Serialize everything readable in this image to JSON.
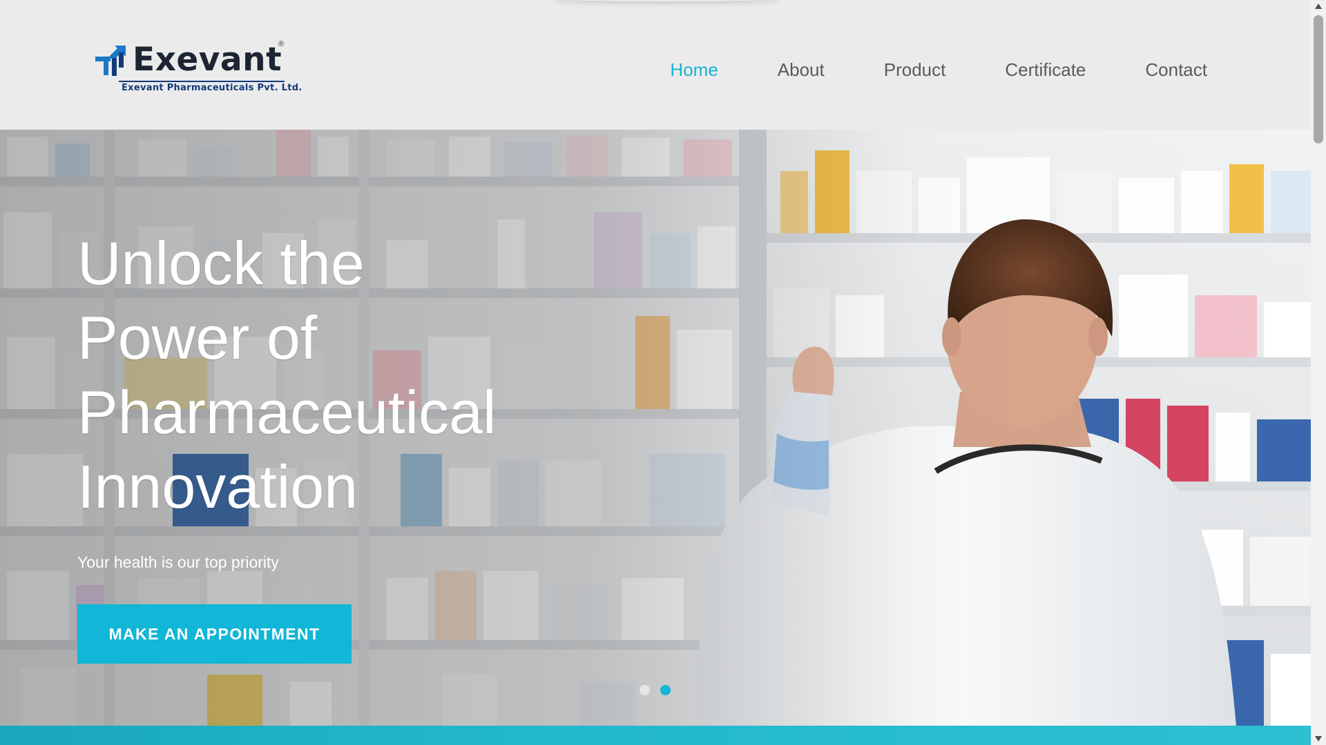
{
  "header": {
    "logo": {
      "name": "Exevant",
      "registered": "®",
      "tagline": "Exevant Pharmaceuticals Pvt. Ltd."
    },
    "nav": [
      {
        "label": "Home",
        "active": true
      },
      {
        "label": "About",
        "active": false
      },
      {
        "label": "Product",
        "active": false
      },
      {
        "label": "Certificate",
        "active": false
      },
      {
        "label": "Contact",
        "active": false
      }
    ]
  },
  "hero": {
    "title_lines": [
      "Unlock the",
      "Power of",
      "Pharmaceutical",
      "Innovation"
    ],
    "subtitle": "Your health is our top priority",
    "cta_label": "MAKE AN APPOINTMENT",
    "carousel": {
      "total_slides": 2,
      "active_slide": 2
    },
    "background_image": "pharmacist-at-pharmacy-shelves"
  },
  "colors": {
    "accent": "#12b6d6",
    "nav_text": "#5a5a5a",
    "brand_dark": "#1d2433",
    "brand_blue": "#123a7a",
    "header_bg": "#ebebeb"
  },
  "icons": {
    "logo_mark": "exevant-arrow-logo-icon",
    "scroll_up": "chevron-up-icon",
    "scroll_down": "chevron-down-icon"
  }
}
